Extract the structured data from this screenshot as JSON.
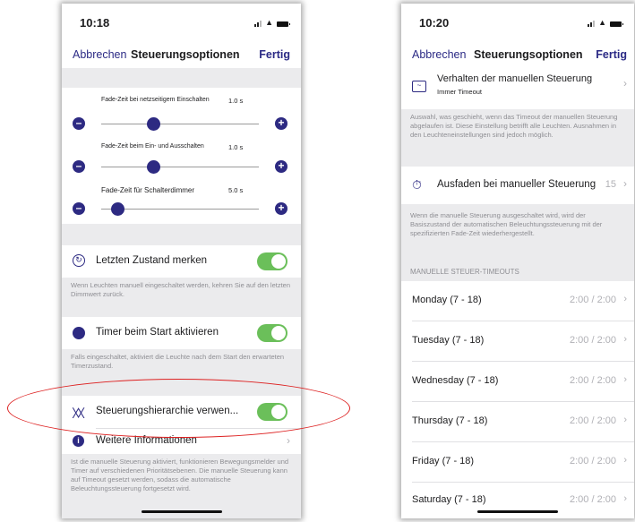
{
  "left": {
    "time": "10:18",
    "nav": {
      "cancel": "Abbrechen",
      "title": "Steuerungsoptionen",
      "done": "Fertig"
    },
    "sliders": [
      {
        "label": "Fade-Zeit bei netzseitigem Einschalten",
        "value": "1.0 s",
        "level": 0.35
      },
      {
        "label": "Fade-Zeit beim Ein- und Ausschalten",
        "value": "1.0 s",
        "level": 0.35
      },
      {
        "label": "Fade-Zeit für Schalterdimmer",
        "value": "5.0 s",
        "level": 0.1
      }
    ],
    "remember": {
      "label": "Letzten Zustand merken",
      "note": "Wenn Leuchten manuell  eingeschaltet werden, kehren Sie auf den letzten Dimmwert zurück."
    },
    "timer": {
      "label": "Timer beim Start aktivieren",
      "note": "Falls eingeschaltet, aktiviert die Leuchte nach dem Start den erwarteten Timerzustand."
    },
    "hierarchy": {
      "label": "Steuerungshierarchie verwen..."
    },
    "info": {
      "label": "Weitere Informationen",
      "note": "Ist die manuelle Steuerung aktiviert, funktionieren Bewegungsmelder und Timer auf verschiedenen Prioritätsebenen. Die manuelle Steuerung kann auf Timeout gesetzt werden, sodass die automatische Beleuchtungssteuerung fortgesetzt wird."
    }
  },
  "right": {
    "time": "10:20",
    "nav": {
      "cancel": "Abbrechen",
      "title": "Steuerungsoptionen",
      "done": "Fertig"
    },
    "behaviour": {
      "label": "Verhalten der manuellen Steuerung",
      "sub": "Immer Timeout",
      "note": "Auswahl, was geschieht, wenn das Timeout der manuellen Steuerung abgelaufen ist. Diese Einstellung betrifft alle Leuchten. Ausnahmen in den Leuchteneinstellungen sind jedoch möglich."
    },
    "fadeout": {
      "label": "Ausfaden bei manueller Steuerung",
      "value": "15",
      "note": "Wenn die manuelle Steuerung ausgeschaltet wird, wird der Basiszustand der automatischen Beleuchtungssteuerung mit der spezifizierten Fade-Zeit wiederhergestellt."
    },
    "section_header": "MANUELLE STEUER-TIMEOUTS",
    "days": [
      {
        "label": "Monday (7 - 18)",
        "value": "2:00 / 2:00"
      },
      {
        "label": "Tuesday (7 - 18)",
        "value": "2:00 / 2:00"
      },
      {
        "label": "Wednesday (7 - 18)",
        "value": "2:00 / 2:00"
      },
      {
        "label": "Thursday (7 - 18)",
        "value": "2:00 / 2:00"
      },
      {
        "label": "Friday (7 - 18)",
        "value": "2:00 / 2:00"
      },
      {
        "label": "Saturday (7 - 18)",
        "value": "2:00 / 2:00"
      }
    ]
  },
  "colors": {
    "accent": "#2d2a82",
    "toggle_on": "#6bbf5a",
    "highlight": "#dd2222"
  },
  "icons": [
    "refresh-icon",
    "clock-icon",
    "hierarchy-icon",
    "info-icon",
    "chart-icon",
    "timer-icon",
    "chevron-right-icon"
  ]
}
